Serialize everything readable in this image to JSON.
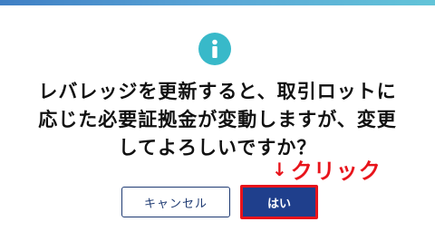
{
  "dialog": {
    "icon": "info-icon",
    "message_lines": [
      "レバレッジを更新すると、取引ロットに",
      "応じた必要証拠金が変動しますが、変更",
      "してよろしいですか？"
    ],
    "cancel_label": "キャンセル",
    "ok_label": "はい"
  },
  "annotation": {
    "arrow": "↓",
    "label": "クリック",
    "color": "#e8141b"
  },
  "colors": {
    "accent": "#38b9c9",
    "primary_button": "#1f3f8c",
    "cancel_border": "#1f3b73",
    "highlight_border": "#e8141b"
  }
}
